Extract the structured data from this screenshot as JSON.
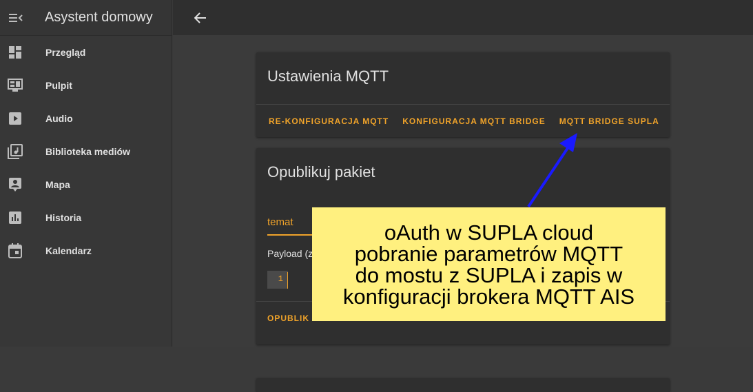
{
  "app": {
    "title": "Asystent domowy"
  },
  "sidebar": {
    "items": [
      {
        "label": "Przegląd",
        "icon": "dashboard-icon"
      },
      {
        "label": "Pulpit",
        "icon": "monitor-dashboard-icon"
      },
      {
        "label": "Audio",
        "icon": "play-box-icon"
      },
      {
        "label": "Biblioteka mediów",
        "icon": "music-library-icon"
      },
      {
        "label": "Mapa",
        "icon": "account-box-icon"
      },
      {
        "label": "Historia",
        "icon": "chart-box-icon"
      },
      {
        "label": "Kalendarz",
        "icon": "calendar-icon"
      }
    ]
  },
  "mqtt_card": {
    "title": "Ustawienia MQTT",
    "buttons": [
      "RE-KONFIGURACJA MQTT",
      "KONFIGURACJA MQTT BRIDGE",
      "MQTT BRIDGE SUPLA"
    ]
  },
  "publish_card": {
    "title": "Opublikuj pakiet",
    "topic_value": "temat",
    "payload_label": "Payload (z",
    "code_line_number": "1",
    "publish_button": "OPUBLIK"
  },
  "annotation": {
    "lines": [
      "oAuth w SUPLA cloud",
      "pobranie parametrów MQTT",
      "do mostu z SUPLA i zapis w",
      "konfiguracji brokera MQTT AIS"
    ]
  },
  "colors": {
    "accent": "#f0a32a",
    "sidebar_bg": "#373737",
    "card_bg": "#2f2f2f",
    "callout_bg": "#fff07f",
    "arrow": "#1a1aff"
  }
}
